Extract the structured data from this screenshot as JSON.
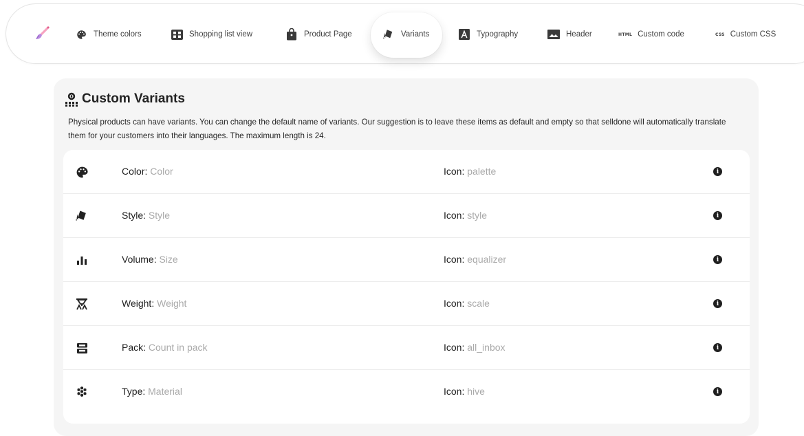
{
  "tabs": [
    {
      "label": "Theme colors",
      "icon": "palette-icon"
    },
    {
      "label": "Shopping list view",
      "icon": "grid-view-icon"
    },
    {
      "label": "Product Page",
      "icon": "shopping-bag-icon"
    },
    {
      "label": "Variants",
      "icon": "style-icon",
      "active": true
    },
    {
      "label": "Typography",
      "icon": "text-format-icon"
    },
    {
      "label": "Header",
      "icon": "panorama-icon"
    },
    {
      "label": "Custom code",
      "icon": "html-icon",
      "icon_text": "HTML"
    },
    {
      "label": "Custom CSS",
      "icon": "css-icon",
      "icon_text": "CSS"
    }
  ],
  "section": {
    "title": "Custom Variants",
    "description": "Physical products can have variants. You can change the default name of variants. Our suggestion is to leave these items as default and empty so that selldone will automatically translate them for your customers into their languages. The maximum length is 24."
  },
  "variants": [
    {
      "name": "Color:",
      "value": "Color",
      "icon_label": "Icon:",
      "icon_value": "palette",
      "icon": "palette-icon"
    },
    {
      "name": "Style:",
      "value": "Style",
      "icon_label": "Icon:",
      "icon_value": "style",
      "icon": "style-icon"
    },
    {
      "name": "Volume:",
      "value": "Size",
      "icon_label": "Icon:",
      "icon_value": "equalizer",
      "icon": "equalizer-icon"
    },
    {
      "name": "Weight:",
      "value": "Weight",
      "icon_label": "Icon:",
      "icon_value": "scale",
      "icon": "scale-icon"
    },
    {
      "name": "Pack:",
      "value": "Count in pack",
      "icon_label": "Icon:",
      "icon_value": "all_inbox",
      "icon": "all-inbox-icon"
    },
    {
      "name": "Type:",
      "value": "Material",
      "icon_label": "Icon:",
      "icon_value": "hive",
      "icon": "hive-icon"
    }
  ],
  "info_glyph": "i",
  "colors": {
    "accent": "#1f1f1f",
    "muted_value": "#a9a9a9",
    "card_bg": "#f5f5f5"
  }
}
